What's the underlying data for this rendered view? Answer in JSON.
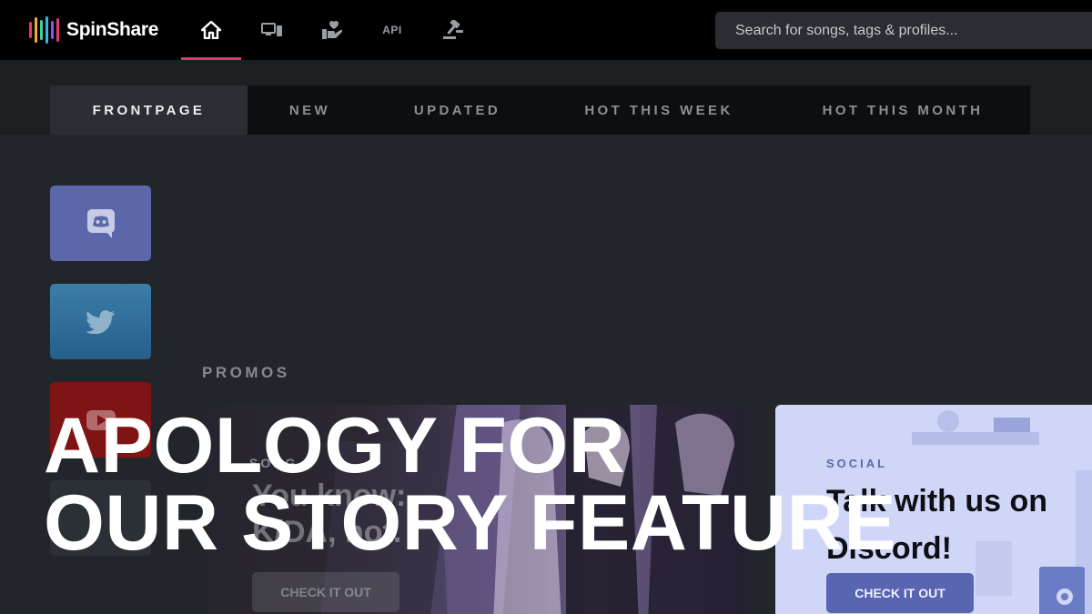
{
  "brand": {
    "name": "SpinShare",
    "bar_colors": [
      "#e8366f",
      "#f3a93a",
      "#3ad0a1",
      "#39b5e0",
      "#7d5cf0",
      "#e8366f"
    ]
  },
  "nav": {
    "items": [
      {
        "id": "home",
        "icon": "home-icon",
        "active": true
      },
      {
        "id": "client",
        "icon": "devices-icon",
        "active": false
      },
      {
        "id": "support",
        "icon": "hand-heart-icon",
        "active": false
      },
      {
        "id": "api",
        "label": "API",
        "active": false
      },
      {
        "id": "moderation",
        "icon": "gavel-icon",
        "active": false
      }
    ],
    "accent": "#e8366f"
  },
  "search": {
    "placeholder": "Search for songs, tags & profiles..."
  },
  "tabs": [
    {
      "label": "FRONTPAGE",
      "active": true
    },
    {
      "label": "NEW",
      "active": false
    },
    {
      "label": "UPDATED",
      "active": false
    },
    {
      "label": "HOT THIS WEEK",
      "active": false
    },
    {
      "label": "HOT THIS MONTH",
      "active": false
    }
  ],
  "socials": [
    {
      "name": "discord",
      "icon": "discord-icon",
      "color": "#5b67a8"
    },
    {
      "name": "twitter",
      "icon": "twitter-icon",
      "color": "#2a79ad"
    },
    {
      "name": "youtube",
      "icon": "youtube-icon",
      "color": "#8a1515"
    }
  ],
  "promos": {
    "heading": "PROMOS",
    "cards": [
      {
        "type": "SONG",
        "title": "You know: K/DA, not.",
        "button": "CHECK IT OUT"
      },
      {
        "type": "SOCIAL",
        "title": "Talk with us on Discord!",
        "button": "CHECK IT OUT"
      }
    ]
  },
  "overlay": {
    "line1": "APOLOGY FOR",
    "line2": "OUR STORY FEATURE"
  }
}
